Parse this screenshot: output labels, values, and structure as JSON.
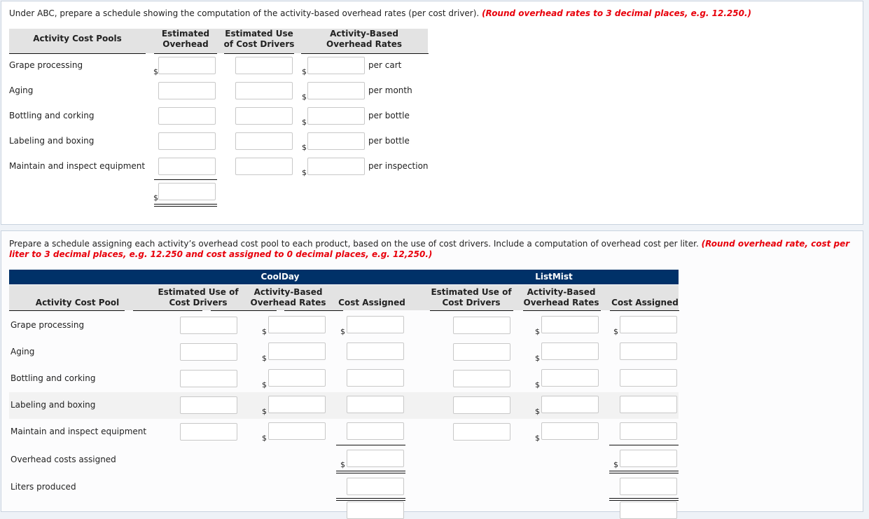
{
  "part1": {
    "instruction": "Under ABC, prepare a schedule showing the computation of the activity-based overhead rates (per cost driver).",
    "instruction_note": "(Round overhead rates to 3 decimal places, e.g. 12.250.)",
    "headers": {
      "pools": "Activity Cost Pools",
      "overhead_1": "Estimated",
      "overhead_2": "Overhead",
      "use_1": "Estimated Use",
      "use_2": "of Cost Drivers",
      "rate_1": "Activity-Based",
      "rate_2": "Overhead Rates"
    },
    "rows": [
      {
        "label": "Grape processing",
        "unit": "per cart",
        "overhead": "",
        "use": "",
        "rate": ""
      },
      {
        "label": "Aging",
        "unit": "per month",
        "overhead": "",
        "use": "",
        "rate": ""
      },
      {
        "label": "Bottling and corking",
        "unit": "per bottle",
        "overhead": "",
        "use": "",
        "rate": ""
      },
      {
        "label": "Labeling and boxing",
        "unit": "per bottle",
        "overhead": "",
        "use": "",
        "rate": ""
      },
      {
        "label": "Maintain and inspect equipment",
        "unit": "per inspection",
        "overhead": "",
        "use": "",
        "rate": ""
      }
    ],
    "total_overhead": "",
    "currency": "$"
  },
  "part2": {
    "instruction_1": "Prepare a schedule assigning each activity’s overhead cost pool to each product, based on the use of cost drivers. Include a computation of overhead cost per liter.",
    "instruction_note_1": "(Round overhead rate, cost per",
    "instruction_note_2": "liter to 3 decimal places, e.g. 12.250 and cost assigned to 0 decimal places, e.g. 12,250.)",
    "products": [
      "CoolDay",
      "ListMist"
    ],
    "headers": {
      "pool": "Activity Cost Pool",
      "use_1": "Estimated Use of",
      "use_2": "Cost Drivers",
      "rate_1": "Activity-Based",
      "rate_2": "Overhead Rates",
      "assigned": "Cost Assigned"
    },
    "rows": [
      {
        "label": "Grape processing"
      },
      {
        "label": "Aging"
      },
      {
        "label": "Bottling and corking"
      },
      {
        "label": "Labeling and boxing"
      },
      {
        "label": "Maintain and inspect equipment"
      }
    ],
    "summary_rows": [
      "Overhead costs assigned",
      "Liters produced"
    ],
    "currency": "$"
  },
  "colors": {
    "accent_navy": "#003168",
    "note_red": "#e8000b",
    "header_gray": "#e3e3e3"
  }
}
